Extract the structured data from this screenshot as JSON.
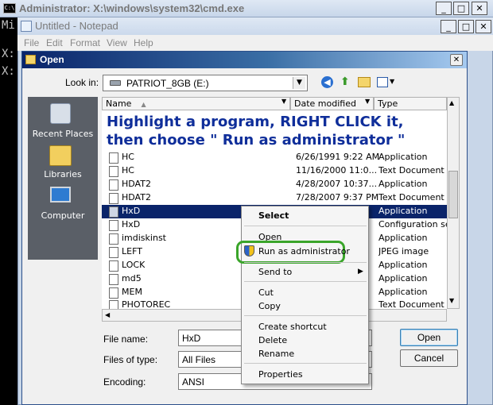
{
  "cmd": {
    "title": "Administrator: X:\\windows\\system32\\cmd.exe",
    "icon_text": "C:\\",
    "lines": [
      "Mi",
      "",
      "X:",
      "",
      "X:"
    ]
  },
  "notepad": {
    "title": "Untitled - Notepad",
    "menu": [
      "File",
      "Edit",
      "Format",
      "View",
      "Help"
    ]
  },
  "caption_buttons": {
    "min": "_",
    "max": "□",
    "close": "✕"
  },
  "dialog": {
    "title": "Open",
    "look_in_label": "Look in:",
    "look_in_value": "PATRIOT_8GB (E:)",
    "places": [
      "Recent Places",
      "Libraries",
      "Computer"
    ],
    "columns": {
      "name": "Name",
      "date": "Date modified",
      "type": "Type"
    },
    "instruction": "Highlight a program, RIGHT CLICK it, then choose \" Run as administrator \"",
    "files": [
      {
        "name": "HC",
        "date": "6/26/1991 9:22 AM",
        "type": "Application"
      },
      {
        "name": "HC",
        "date": "11/16/2000 11:0...",
        "type": "Text Document"
      },
      {
        "name": "HDAT2",
        "date": "4/28/2007 10:37...",
        "type": "Application"
      },
      {
        "name": "HDAT2",
        "date": "7/28/2007 9:37 PM",
        "type": "Text Document"
      },
      {
        "name": "HxD",
        "date": "",
        "type": "Application"
      },
      {
        "name": "HxD",
        "date": "",
        "type": "Configuration se..."
      },
      {
        "name": "imdiskinst",
        "date": "",
        "type": "Application"
      },
      {
        "name": "LEFT",
        "date": "",
        "type": "JPEG image"
      },
      {
        "name": "LOCK",
        "date": "",
        "type": "Application"
      },
      {
        "name": "md5",
        "date": "",
        "type": "Application"
      },
      {
        "name": "MEM",
        "date": "",
        "type": "Application"
      },
      {
        "name": "PHOTOREC",
        "date": "",
        "type": "Text Document"
      }
    ],
    "file_name_label": "File name:",
    "file_name_value": "HxD",
    "files_of_type_label": "Files of type:",
    "files_of_type_value": "All Files",
    "encoding_label": "Encoding:",
    "encoding_value": "ANSI",
    "open_button": "Open",
    "cancel_button": "Cancel"
  },
  "context_menu": {
    "select": "Select",
    "open": "Open",
    "run_as_admin": "Run as administrator",
    "send_to": "Send to",
    "cut": "Cut",
    "copy": "Copy",
    "create_shortcut": "Create shortcut",
    "delete": "Delete",
    "rename": "Rename",
    "properties": "Properties"
  },
  "colors": {
    "selection": "#0a246a",
    "highlight_ring": "#3aa52a",
    "instruction_text": "#0f2e9a",
    "accent": "#2b4f8a"
  }
}
